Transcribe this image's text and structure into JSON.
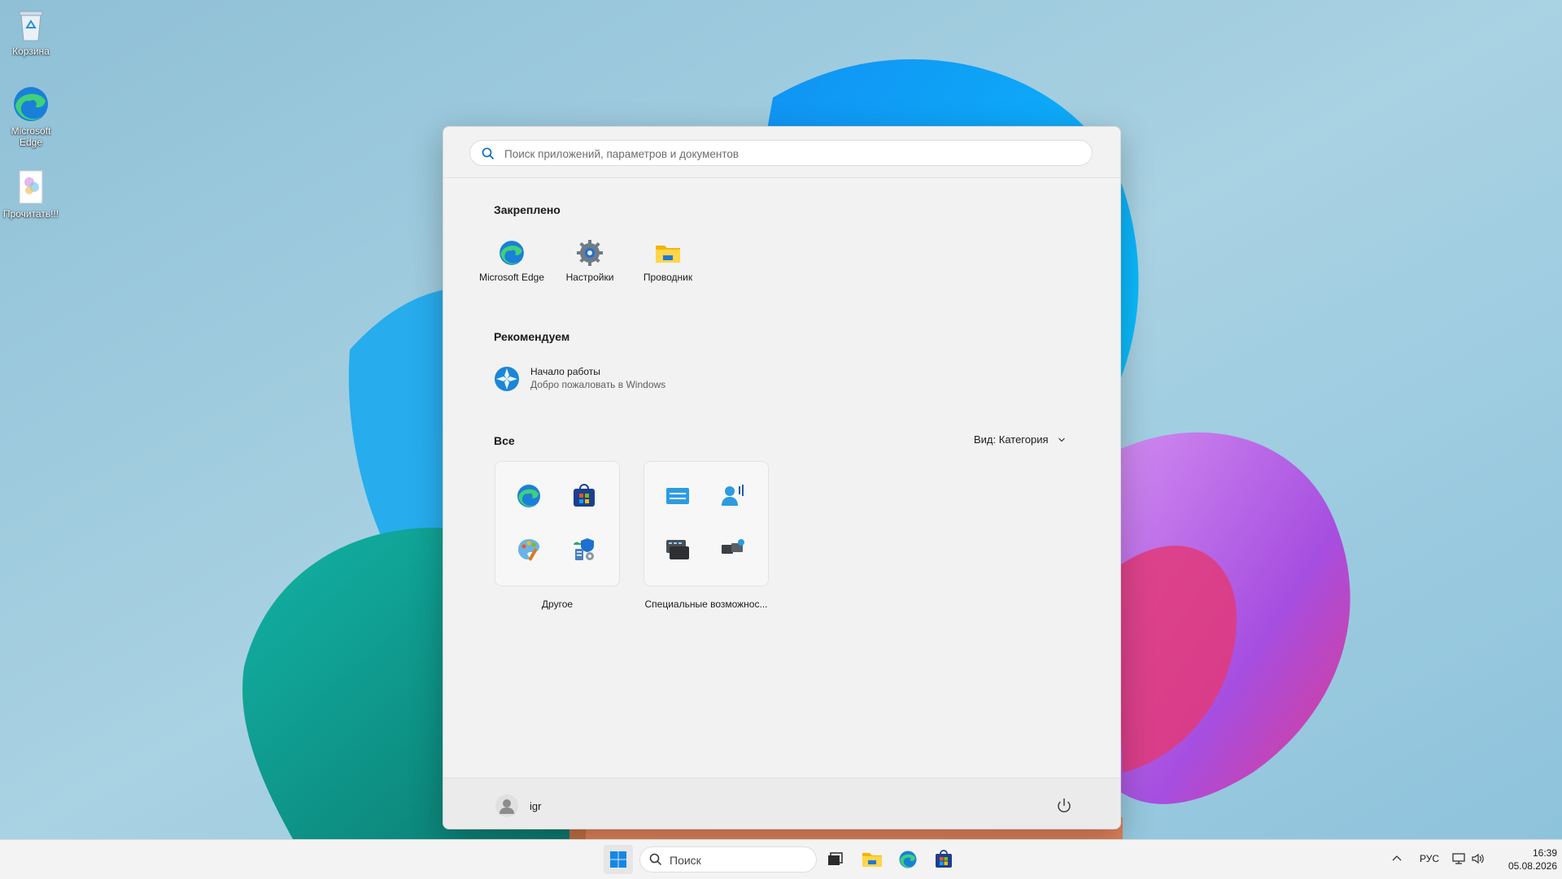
{
  "desktop": {
    "icons": [
      {
        "label": "Корзина",
        "icon": "recycle-bin-icon"
      },
      {
        "label": "Microsoft Edge",
        "icon": "edge-icon"
      },
      {
        "label": "Прочитать!!!",
        "icon": "document-icon"
      }
    ]
  },
  "start_menu": {
    "search_placeholder": "Поиск приложений, параметров и документов",
    "pinned_title": "Закреплено",
    "pinned": [
      {
        "label": "Microsoft Edge",
        "icon": "edge-icon"
      },
      {
        "label": "Настройки",
        "icon": "settings-gear-icon"
      },
      {
        "label": "Проводник",
        "icon": "file-explorer-icon"
      }
    ],
    "recommended_title": "Рекомендуем",
    "recommended": [
      {
        "title": "Начало работы",
        "subtitle": "Добро пожаловать в Windows",
        "icon": "get-started-icon"
      }
    ],
    "all_title": "Все",
    "view_label": "Вид: Категория",
    "categories": [
      {
        "label": "Другое",
        "icons": [
          "edge-icon",
          "store-icon",
          "paint-icon",
          "windows-tools-icon"
        ]
      },
      {
        "label": "Специальные возможнос...",
        "icons": [
          "on-screen-keyboard-icon",
          "voice-access-icon",
          "narrator-icon",
          "remote-desktop-icon"
        ]
      }
    ],
    "user_name": "igr"
  },
  "taskbar": {
    "search_label": "Поиск",
    "apps": [
      "start-icon",
      "task-view-icon",
      "file-explorer-icon",
      "edge-icon",
      "store-icon"
    ],
    "language": "РУС",
    "time": "16:39",
    "date": "05.08.2026"
  },
  "colors": {
    "accent": "#0067c0",
    "start_bg": "#f2f2f2",
    "taskbar_bg": "#f3f3f3"
  }
}
